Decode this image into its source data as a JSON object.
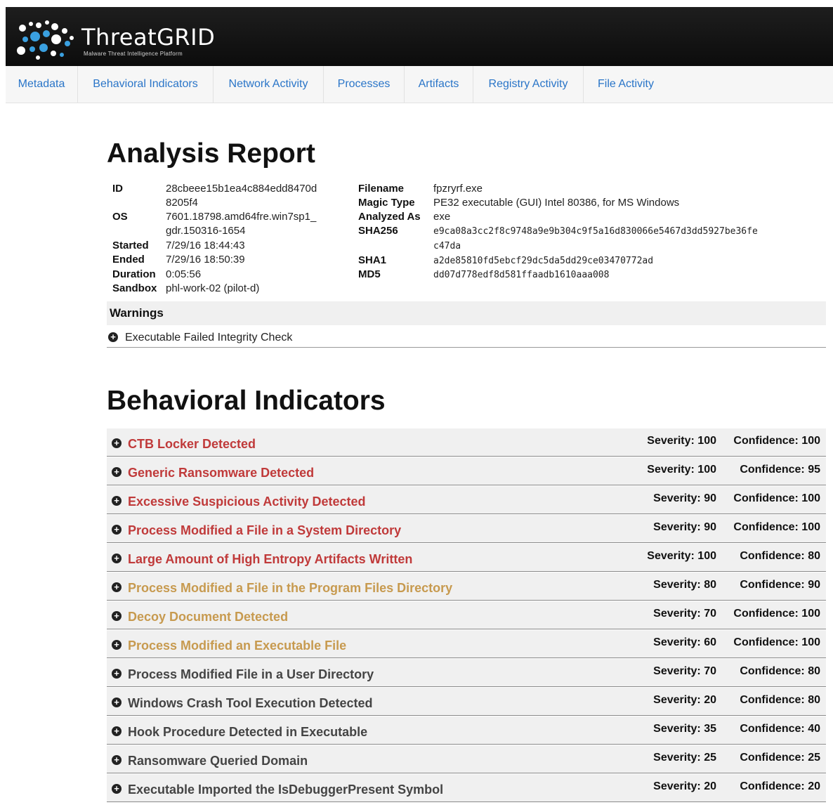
{
  "header": {
    "logo_name": "ThreatGRID",
    "logo_tagline": "Malware Threat Intelligence Platform"
  },
  "nav": {
    "tabs": [
      {
        "label": "Metadata"
      },
      {
        "label": "Behavioral Indicators"
      },
      {
        "label": "Network Activity"
      },
      {
        "label": "Processes"
      },
      {
        "label": "Artifacts"
      },
      {
        "label": "Registry Activity"
      },
      {
        "label": "File Activity"
      }
    ]
  },
  "report": {
    "title": "Analysis Report",
    "left": {
      "id_label": "ID",
      "id_line1": "28cbeee15b1ea4c884edd8470d",
      "id_line2": "8205f4",
      "os_label": "OS",
      "os_line1": "7601.18798.amd64fre.win7sp1_",
      "os_line2": "gdr.150316-1654",
      "started_label": "Started",
      "started": "7/29/16 18:44:43",
      "ended_label": "Ended",
      "ended": "7/29/16 18:50:39",
      "duration_label": "Duration",
      "duration": "0:05:56",
      "sandbox_label": "Sandbox",
      "sandbox": "phl-work-02 (pilot-d)"
    },
    "right": {
      "filename_label": "Filename",
      "filename": "fpzryrf.exe",
      "magic_label": "Magic Type",
      "magic": "PE32 executable (GUI) Intel 80386, for MS Windows",
      "analyzed_label": "Analyzed As",
      "analyzed": "exe",
      "sha256_label": "SHA256",
      "sha256_line1": "e9ca08a3cc2f8c9748a9e9b304c9f5a16d830066e5467d3dd5927be36fe",
      "sha256_line2": "c47da",
      "sha1_label": "SHA1",
      "sha1": "a2de85810fd5ebcf29dc5da5dd29ce03470772ad",
      "md5_label": "MD5",
      "md5": "dd07d778edf8d581ffaadb1610aaa008"
    },
    "warnings_heading": "Warnings",
    "warnings": [
      {
        "text": "Executable Failed Integrity Check"
      }
    ]
  },
  "indicators": {
    "title": "Behavioral Indicators",
    "colors": {
      "red": "#c03a3a",
      "amber": "#c79a4f",
      "gray": "#444444"
    },
    "items": [
      {
        "title": "CTB Locker Detected",
        "severity": "Severity: 100",
        "confidence": "Confidence: 100",
        "level": "red"
      },
      {
        "title": "Generic Ransomware Detected",
        "severity": "Severity: 100",
        "confidence": "Confidence: 95",
        "level": "red"
      },
      {
        "title": "Excessive Suspicious Activity Detected",
        "severity": "Severity: 90",
        "confidence": "Confidence: 100",
        "level": "red"
      },
      {
        "title": "Process Modified a File in a System Directory",
        "severity": "Severity: 90",
        "confidence": "Confidence: 100",
        "level": "red"
      },
      {
        "title": "Large Amount of High Entropy Artifacts Written",
        "severity": "Severity: 100",
        "confidence": "Confidence: 80",
        "level": "red"
      },
      {
        "title": "Process Modified a File in the Program Files Directory",
        "severity": "Severity: 80",
        "confidence": "Confidence: 90",
        "level": "amber"
      },
      {
        "title": "Decoy Document Detected",
        "severity": "Severity: 70",
        "confidence": "Confidence: 100",
        "level": "amber"
      },
      {
        "title": "Process Modified an Executable File",
        "severity": "Severity: 60",
        "confidence": "Confidence: 100",
        "level": "amber"
      },
      {
        "title": "Process Modified File in a User Directory",
        "severity": "Severity: 70",
        "confidence": "Confidence: 80",
        "level": "gray"
      },
      {
        "title": "Windows Crash Tool Execution Detected",
        "severity": "Severity: 20",
        "confidence": "Confidence: 80",
        "level": "gray"
      },
      {
        "title": "Hook Procedure Detected in Executable",
        "severity": "Severity: 35",
        "confidence": "Confidence: 40",
        "level": "gray"
      },
      {
        "title": "Ransomware Queried Domain",
        "severity": "Severity: 25",
        "confidence": "Confidence: 25",
        "level": "gray"
      },
      {
        "title": "Executable Imported the IsDebuggerPresent Symbol",
        "severity": "Severity: 20",
        "confidence": "Confidence: 20",
        "level": "gray"
      }
    ]
  }
}
